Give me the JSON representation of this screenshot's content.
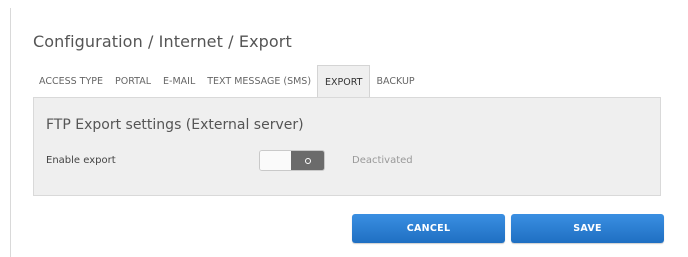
{
  "page": {
    "title": "Configuration / Internet / Export"
  },
  "tabs": [
    {
      "label": "ACCESS TYPE",
      "active": false
    },
    {
      "label": "PORTAL",
      "active": false
    },
    {
      "label": "E-MAIL",
      "active": false
    },
    {
      "label": "TEXT MESSAGE (SMS)",
      "active": false
    },
    {
      "label": "EXPORT",
      "active": true
    },
    {
      "label": "BACKUP",
      "active": false
    }
  ],
  "panel": {
    "title": "FTP Export settings (External server)",
    "enable_export": {
      "label": "Enable export",
      "enabled": false,
      "status_text": "Deactivated"
    }
  },
  "actions": {
    "cancel_label": "CANCEL",
    "save_label": "SAVE"
  },
  "colors": {
    "button": "#2a7fd6",
    "panel_background": "#efefef",
    "toggle_knob": "#6b6b6b"
  },
  "icons": {
    "toggle_knob": "circle-icon"
  }
}
